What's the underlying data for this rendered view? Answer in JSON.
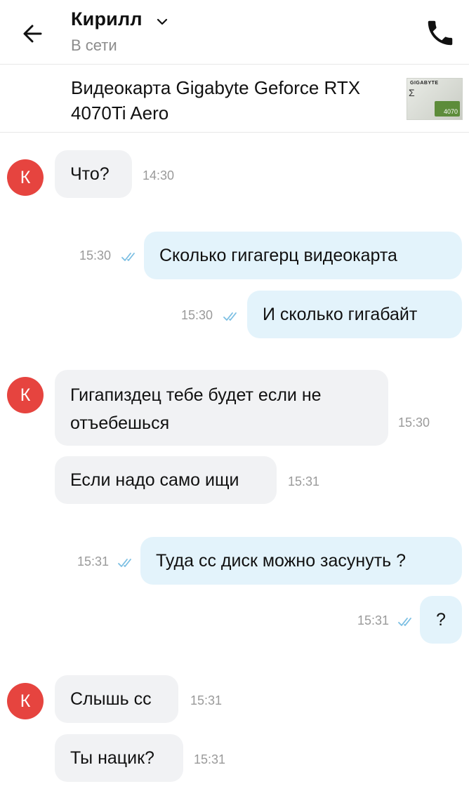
{
  "header": {
    "contact_name": "Кирилл",
    "status": "В сети"
  },
  "product": {
    "title": "Видеокарта Gigabyte Geforce RTX 4070Ti Aero",
    "thumb_brand": "GIGABYTE",
    "thumb_model": "4070"
  },
  "avatar_letter": "К",
  "messages": [
    {
      "text": "Что?",
      "time": "14:30"
    },
    {
      "text": "Сколько гигагерц видеокарта",
      "time": "15:30"
    },
    {
      "text": "И сколько гигабайт",
      "time": "15:30"
    },
    {
      "text_line1": "Гигапиздец тебе будет если не",
      "text_line2": "отъебешься",
      "time": "15:30"
    },
    {
      "text": "Если надо само ищи",
      "time": "15:31"
    },
    {
      "text": "Туда сс диск можно засунуть ?",
      "time": "15:31"
    },
    {
      "text": "?",
      "time": "15:31"
    },
    {
      "text": "Слышь сс",
      "time": "15:31"
    },
    {
      "text": "Ты нацик?",
      "time": "15:31"
    }
  ],
  "colors": {
    "incoming_bubble": "#f1f2f4",
    "outgoing_bubble": "#e3f3fb",
    "avatar": "#e6443f",
    "read_checks": "#7bbfe3"
  }
}
